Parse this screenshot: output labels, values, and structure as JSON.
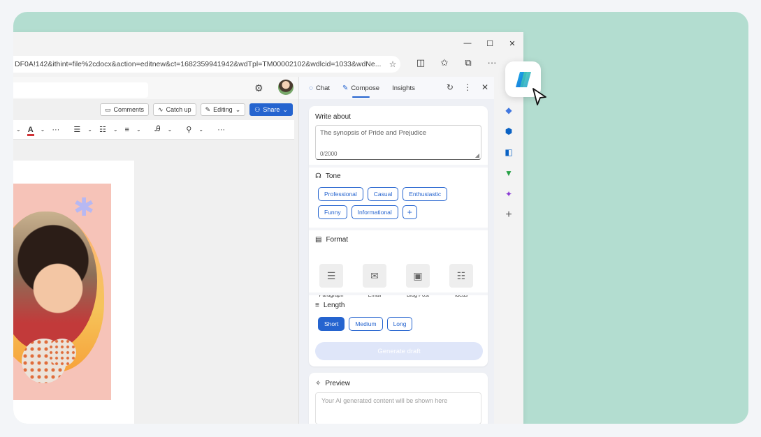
{
  "browser": {
    "url": "DF0A!142&ithint=file%2cdocx&action=editnew&ct=1682359941942&wdTpl=TM00002102&wdlcid=1033&wdNe...",
    "window_controls": [
      "—",
      "☐",
      "✕"
    ]
  },
  "word": {
    "actions": {
      "comments": "Comments",
      "catch_up": "Catch up",
      "editing": "Editing",
      "share": "Share"
    }
  },
  "copilot": {
    "tabs": [
      "Chat",
      "Compose",
      "Insights"
    ],
    "active_tab": "Compose",
    "write_about": {
      "label": "Write about",
      "value": "The synopsis of Pride and Prejudice",
      "counter": "0/2000"
    },
    "tone": {
      "label": "Tone",
      "options": [
        "Professional",
        "Casual",
        "Enthusiastic",
        "Funny",
        "Informational"
      ],
      "add": "+"
    },
    "format": {
      "label": "Format",
      "options": [
        "Paragraph",
        "Email",
        "Blog Post",
        "Ideas"
      ]
    },
    "length": {
      "label": "Length",
      "options": [
        "Short",
        "Medium",
        "Long"
      ],
      "selected": "Short"
    },
    "generate_label": "Generate draft",
    "preview": {
      "label": "Preview",
      "placeholder": "Your AI generated content will be shown here"
    }
  },
  "colors": {
    "accent": "#2564cf",
    "stage_bg": "#b3ddd0",
    "art_bg": "#f6c3b8"
  }
}
